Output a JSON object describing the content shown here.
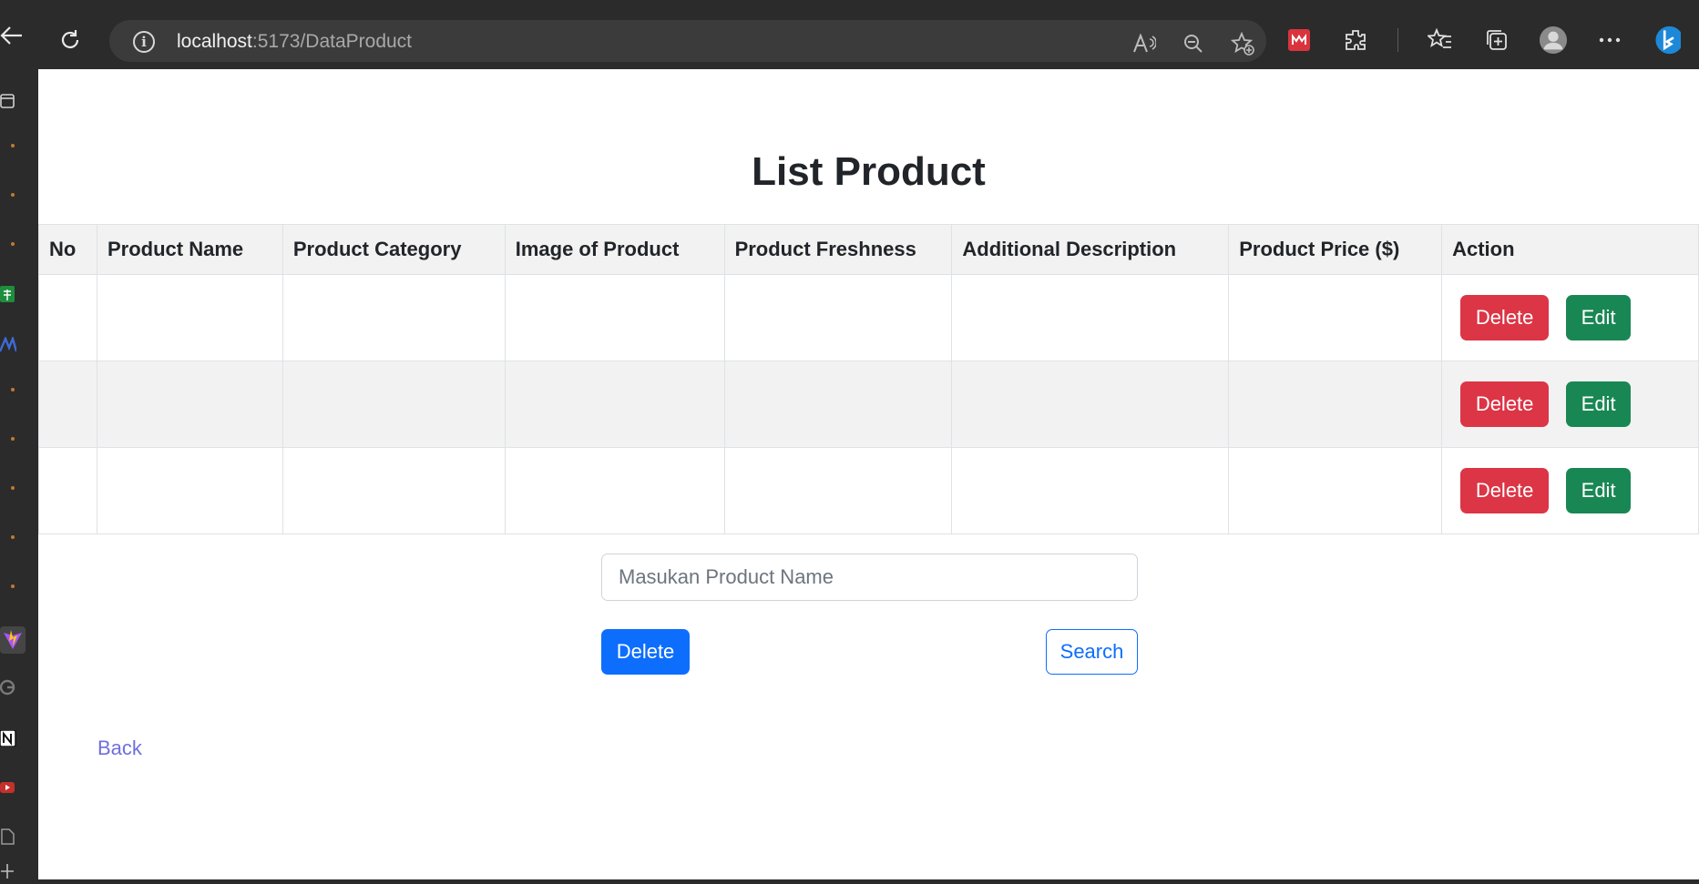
{
  "browser": {
    "url_host": "localhost",
    "url_path": ":5173/DataProduct"
  },
  "page": {
    "title": "List Product"
  },
  "table": {
    "headers": [
      "No",
      "Product Name",
      "Product Category",
      "Image of Product",
      "Product Freshness",
      "Additional Description",
      "Product Price ($)",
      "Action"
    ],
    "rows": [
      {
        "delete_label": "Delete",
        "edit_label": "Edit"
      },
      {
        "delete_label": "Delete",
        "edit_label": "Edit"
      },
      {
        "delete_label": "Delete",
        "edit_label": "Edit"
      }
    ]
  },
  "search": {
    "placeholder": "Masukan Product Name",
    "delete_label": "Delete",
    "search_label": "Search"
  },
  "back_label": "Back",
  "colors": {
    "danger": "#dc3545",
    "success": "#198754",
    "primary": "#0d6efd",
    "link": "#6f6fde"
  }
}
